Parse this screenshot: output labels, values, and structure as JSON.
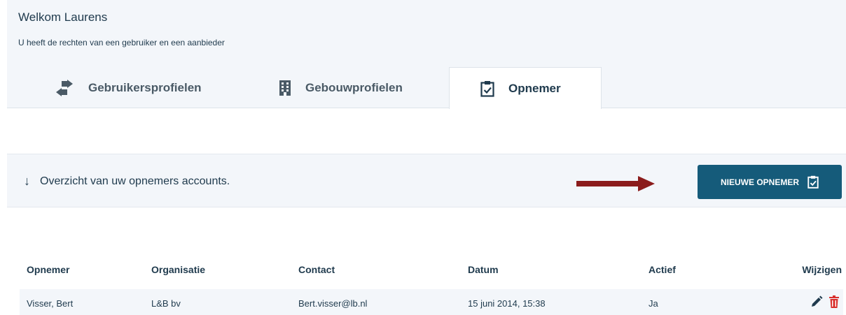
{
  "header": {
    "welcome": "Welkom Laurens",
    "rights": "U heeft de rechten van een gebruiker en een aanbieder"
  },
  "tabs": [
    {
      "label": "Gebruikersprofielen",
      "icon": "arrows-exchange-icon",
      "active": false
    },
    {
      "label": "Gebouwprofielen",
      "icon": "building-icon",
      "active": false
    },
    {
      "label": "Opnemer",
      "icon": "clipboard-check-icon",
      "active": true
    }
  ],
  "overview": {
    "arrow": "↓",
    "text": "Overzicht van uw opnemers accounts.",
    "new_button_label": "NIEUWE OPNEMER"
  },
  "table": {
    "columns": [
      "Opnemer",
      "Organisatie",
      "Contact",
      "Datum",
      "Actief",
      "Wijzigen"
    ],
    "rows": [
      [
        "Visser, Bert",
        "L&B bv",
        "Bert.visser@lb.nl",
        "15 juni 2014, 15:38",
        "Ja"
      ]
    ]
  },
  "colors": {
    "accent": "#155b7a",
    "annotation_arrow": "#8b1c1c",
    "delete": "#d9302c",
    "panel_bg": "#f3f6fa"
  }
}
